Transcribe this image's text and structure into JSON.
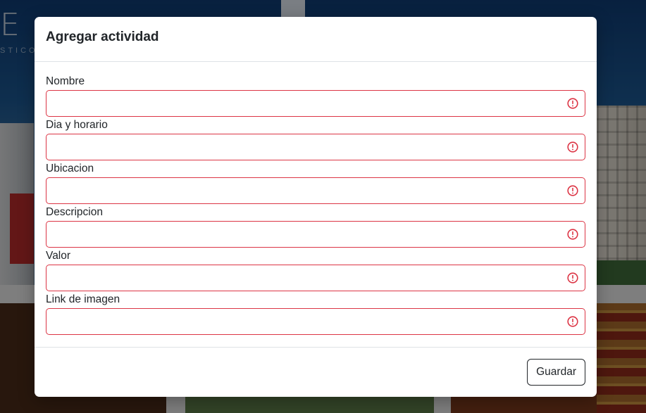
{
  "background": {
    "logo_letter": "E",
    "logo_subtitle": "STICO"
  },
  "modal": {
    "title": "Agregar actividad",
    "fields": [
      {
        "label": "Nombre",
        "value": ""
      },
      {
        "label": "Dia y horario",
        "value": ""
      },
      {
        "label": "Ubicacion",
        "value": ""
      },
      {
        "label": "Descripcion",
        "value": ""
      },
      {
        "label": "Valor",
        "value": ""
      },
      {
        "label": "Link de imagen",
        "value": ""
      }
    ],
    "save_label": "Guardar"
  },
  "colors": {
    "invalid": "#dc3545",
    "text": "#212529",
    "divider": "#dee2e6"
  },
  "icons": {
    "invalid": "exclamation-circle-icon"
  }
}
